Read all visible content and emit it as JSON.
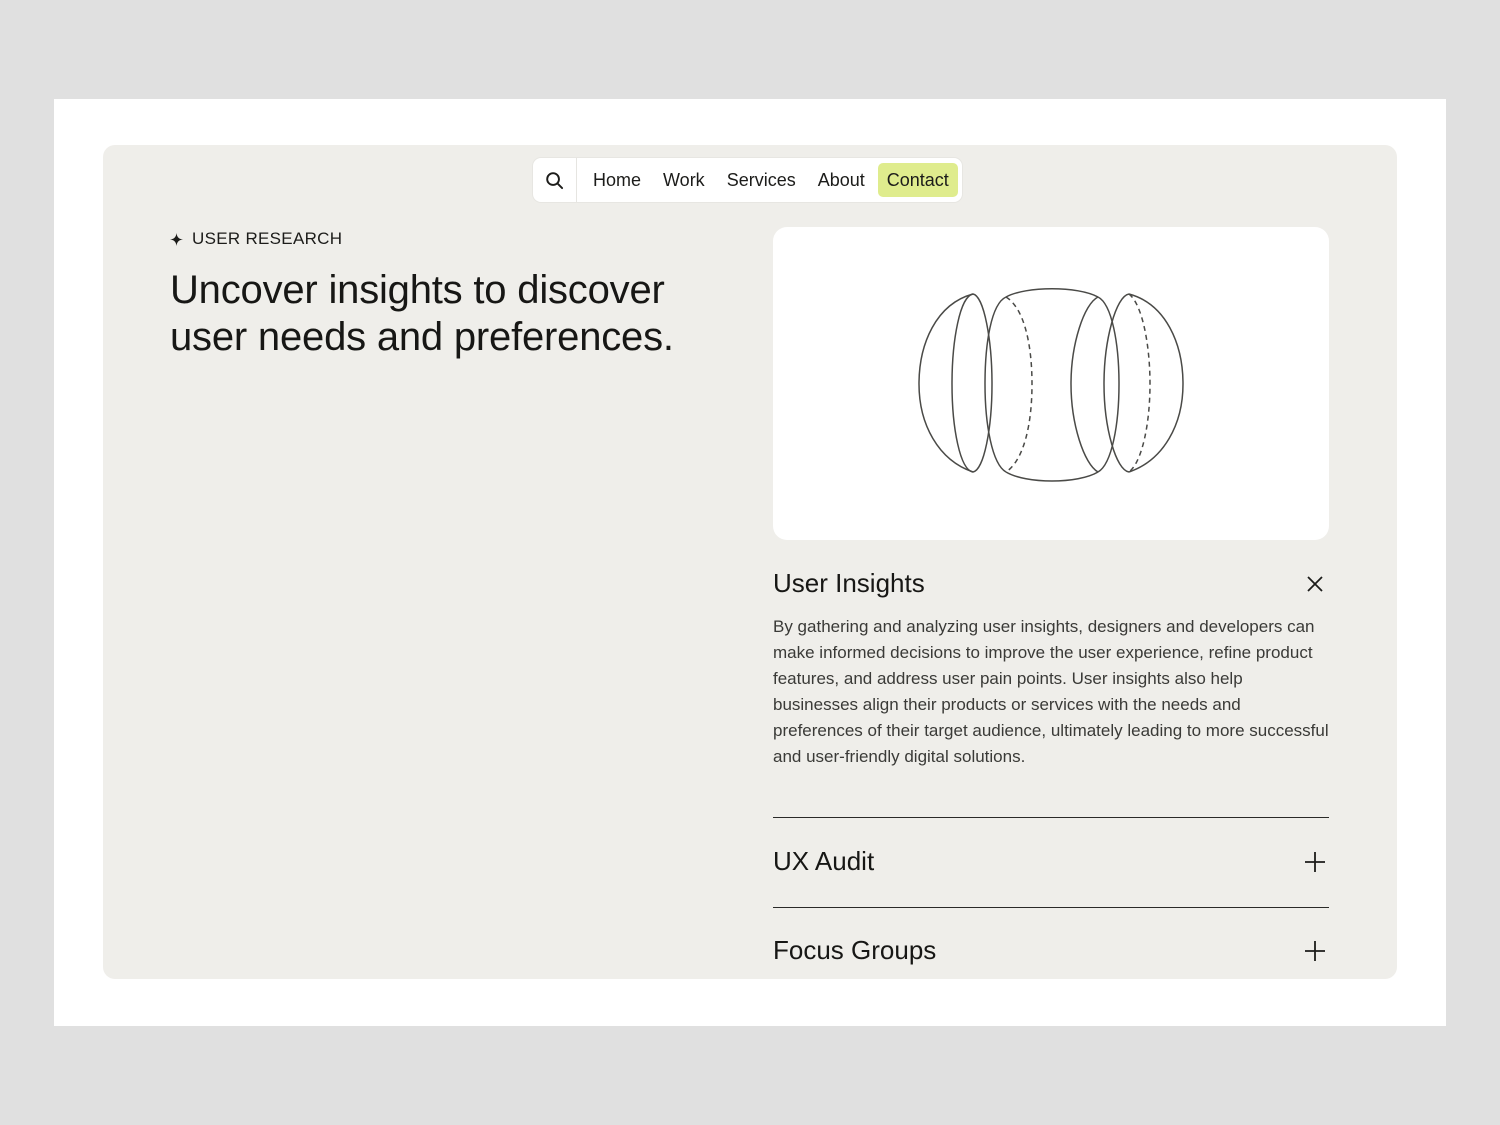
{
  "nav": {
    "search_icon": "search-icon",
    "items": [
      {
        "label": "Home"
      },
      {
        "label": "Work"
      },
      {
        "label": "Services"
      },
      {
        "label": "About"
      },
      {
        "label": "Contact",
        "active": true
      }
    ],
    "active_color": "#dfec8d"
  },
  "hero": {
    "eyebrow": "USER RESEARCH",
    "eyebrow_icon": "sparkle-icon",
    "headline": "Uncover insights to discover user needs and preferences."
  },
  "illustration": {
    "icon": "segmented-sphere-illustration"
  },
  "accordion": [
    {
      "title": "User Insights",
      "expanded": true,
      "icon": "close-icon",
      "body": "By gathering and analyzing user insights, designers and developers can make informed decisions to improve the user experience, refine product features, and address user pain points. User insights also help businesses align their products or services with the needs and preferences of their target audience, ultimately leading to more successful and user-friendly digital solutions."
    },
    {
      "title": "UX Audit",
      "expanded": false,
      "icon": "plus-icon"
    },
    {
      "title": "Focus Groups",
      "expanded": false,
      "icon": "plus-icon"
    }
  ],
  "colors": {
    "page_background": "#e0e0e0",
    "panel_background": "#efeeea",
    "card_background": "#ffffff",
    "text": "#171715"
  }
}
